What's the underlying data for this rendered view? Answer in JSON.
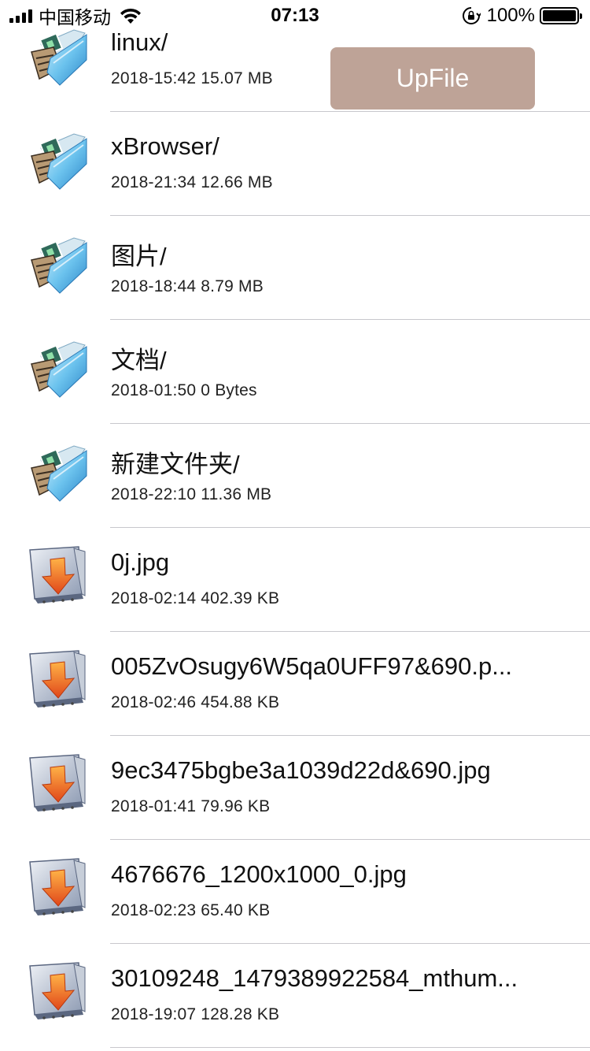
{
  "status_bar": {
    "carrier": "中国移动",
    "time": "07:13",
    "battery_percent": "100%"
  },
  "upload_button": {
    "label": "UpFile"
  },
  "files": [
    {
      "name": "linux/",
      "meta": "2018-15:42 15.07 MB",
      "type": "folder",
      "icon": "folder-icon"
    },
    {
      "name": "xBrowser/",
      "meta": "2018-21:34 12.66 MB",
      "type": "folder",
      "icon": "folder-icon"
    },
    {
      "name": "图片/",
      "meta": "2018-18:44 8.79 MB",
      "type": "folder",
      "icon": "folder-icon"
    },
    {
      "name": "文档/",
      "meta": "2018-01:50 0 Bytes",
      "type": "folder",
      "icon": "folder-icon"
    },
    {
      "name": "新建文件夹/",
      "meta": "2018-22:10 11.36 MB",
      "type": "folder",
      "icon": "folder-icon"
    },
    {
      "name": "0j.jpg",
      "meta": "2018-02:14 402.39 KB",
      "type": "file",
      "icon": "download-file-icon"
    },
    {
      "name": "005ZvOsugy6W5qa0UFF97&690.p...",
      "meta": "2018-02:46 454.88 KB",
      "type": "file",
      "icon": "download-file-icon"
    },
    {
      "name": "9ec3475bgbe3a1039d22d&690.jpg",
      "meta": "2018-01:41 79.96 KB",
      "type": "file",
      "icon": "download-file-icon"
    },
    {
      "name": "4676676_1200x1000_0.jpg",
      "meta": "2018-02:23 65.40 KB",
      "type": "file",
      "icon": "download-file-icon"
    },
    {
      "name": "30109248_1479389922584_mthum...",
      "meta": "2018-19:07 128.28 KB",
      "type": "file",
      "icon": "download-file-icon"
    }
  ]
}
